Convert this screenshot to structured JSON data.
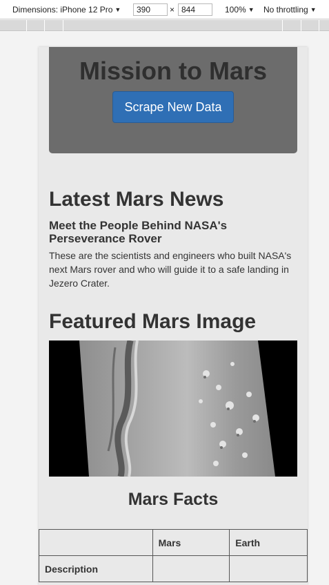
{
  "devtools": {
    "device": "Dimensions: iPhone 12 Pro",
    "width": "390",
    "times": "×",
    "height": "844",
    "zoom": "100%",
    "throttling": "No throttling"
  },
  "jumbotron": {
    "title": "Mission to Mars",
    "button_label": "Scrape New Data"
  },
  "news": {
    "heading": "Latest Mars News",
    "title": "Meet the People Behind NASA's Perseverance Rover",
    "teaser": "These are the scientists and engineers who built NASA's next Mars rover and who will guide it to a safe landing in Jezero Crater."
  },
  "featured_image": {
    "heading": "Featured Mars Image"
  },
  "facts": {
    "heading": "Mars Facts",
    "columns": [
      "",
      "Mars",
      "Earth"
    ],
    "rows": [
      [
        "Description",
        "",
        ""
      ]
    ]
  }
}
